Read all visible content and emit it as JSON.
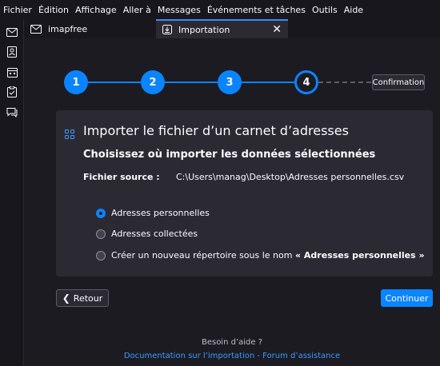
{
  "menubar": {
    "items": [
      {
        "label": "Fichier"
      },
      {
        "label": "Édition"
      },
      {
        "label": "Affichage"
      },
      {
        "label": "Aller à"
      },
      {
        "label": "Messages"
      },
      {
        "label": "Événements et tâches"
      },
      {
        "label": "Outils"
      },
      {
        "label": "Aide"
      }
    ]
  },
  "spaces": {
    "icons": [
      "mail-icon",
      "address-book-icon",
      "calendar-icon",
      "tasks-icon",
      "chat-icon"
    ]
  },
  "tabs": [
    {
      "label": "imapfree",
      "icon": "mail-folder-icon"
    },
    {
      "label": "Importation",
      "icon": "import-icon"
    }
  ],
  "stepper": {
    "steps": [
      "1",
      "2",
      "3",
      "4"
    ],
    "current_step": 4,
    "final_label": "Confirmation"
  },
  "card": {
    "title": "Importer le fichier d’un carnet d’adresses",
    "subtitle": "Choisissez où importer les données sélectionnées",
    "source_label": "Fichier source :",
    "source_value": "C:\\Users\\manag\\Desktop\\Adresses personnelles.csv",
    "options": [
      {
        "label": "Adresses personnelles",
        "checked": true
      },
      {
        "label": "Adresses collectées",
        "checked": false
      },
      {
        "label_prefix": "Créer un nouveau répertoire sous le nom ",
        "label_bold": "« Adresses personnelles »",
        "checked": false
      }
    ]
  },
  "buttons": {
    "back": "Retour",
    "continue": "Continuer"
  },
  "footer": {
    "help": "Besoin d’aide ?",
    "link_docs": "Documentation sur l’importation",
    "separator": " - ",
    "link_forum": "Forum d’assistance"
  },
  "colors": {
    "accent": "#0a84ff",
    "background": "#1c1b22",
    "card": "#2b2a33"
  }
}
